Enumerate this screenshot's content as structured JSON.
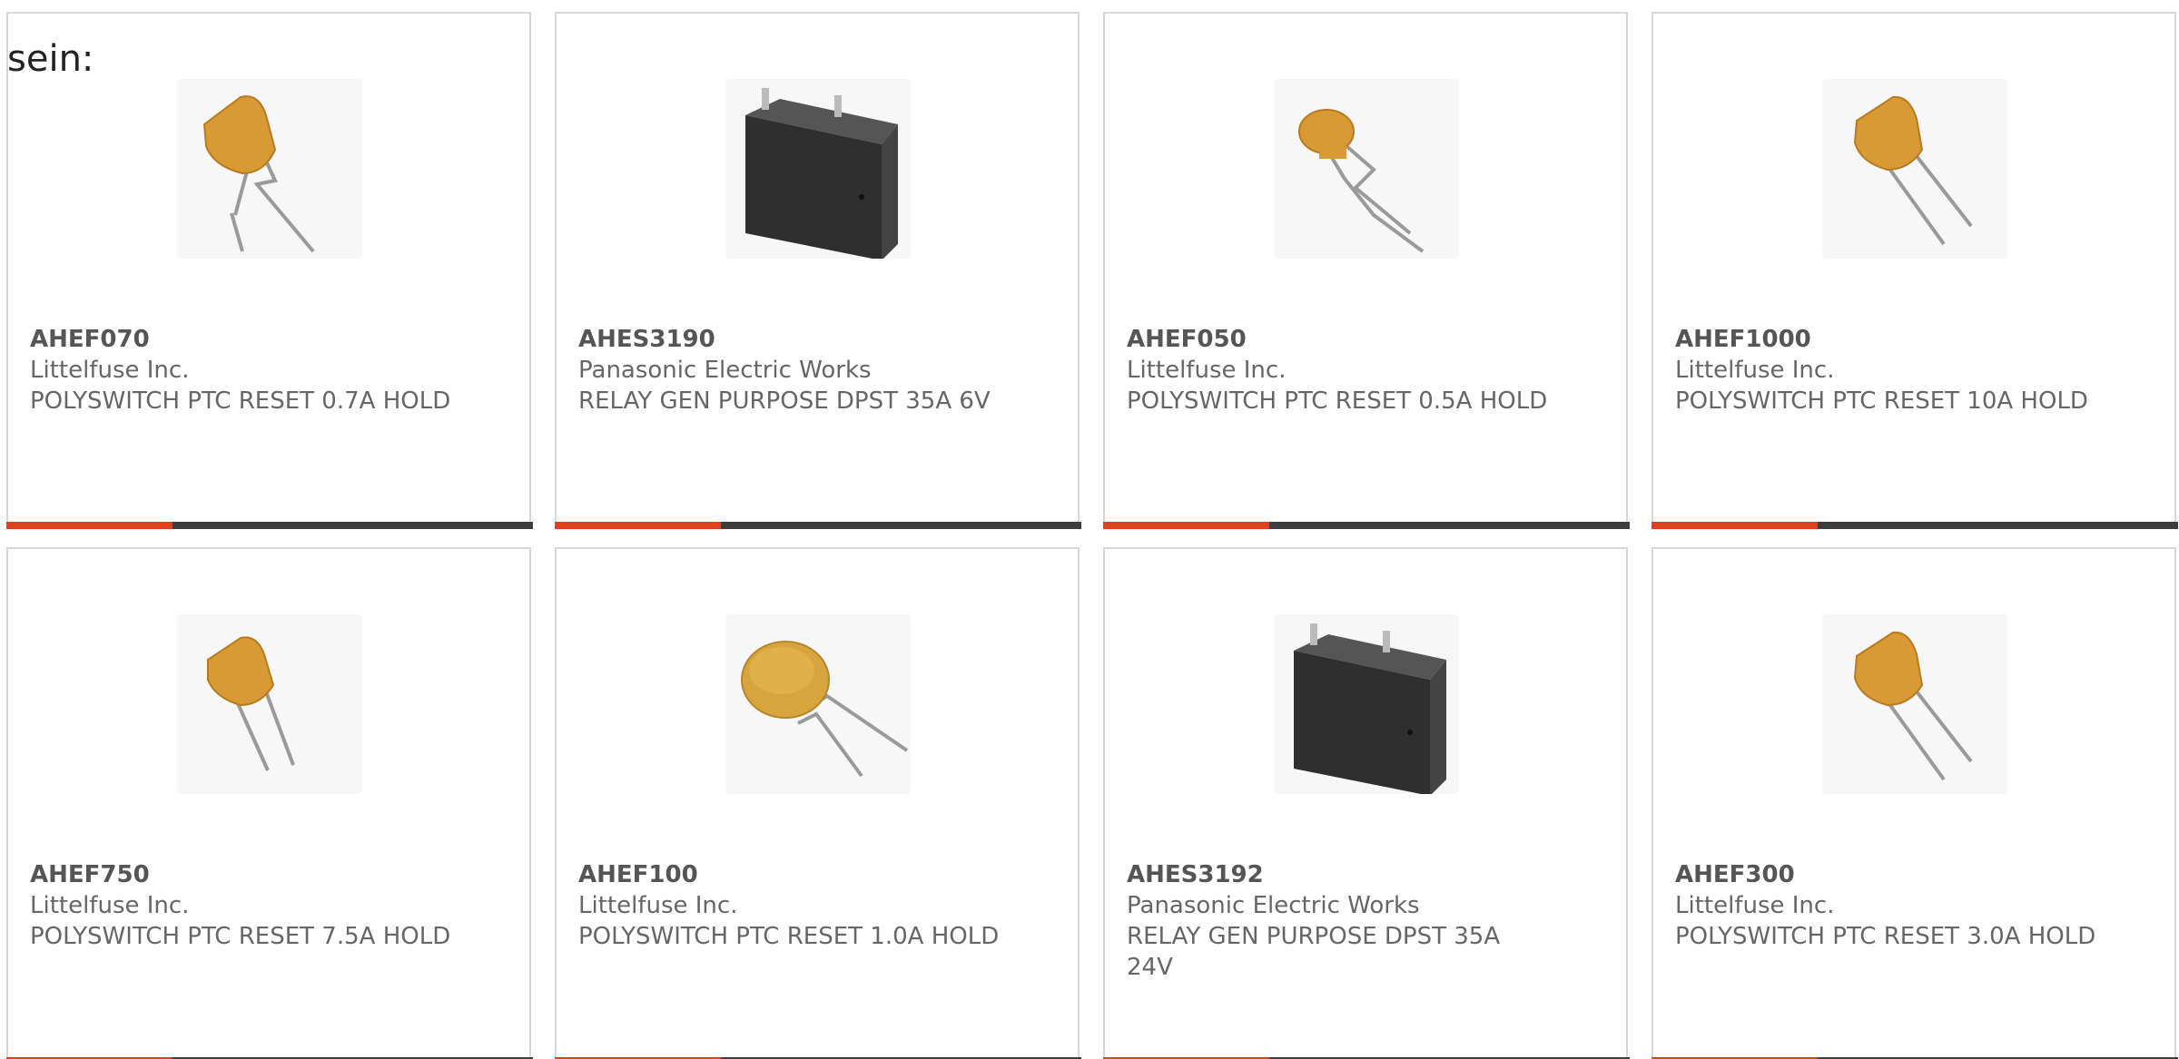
{
  "intro_text": "sein:",
  "colors": {
    "accent": "#e2401c",
    "bar": "#3d3d3d",
    "text": "#666666",
    "border": "#d8d8d8"
  },
  "products": [
    {
      "part_number": "AHEF070",
      "manufacturer": "Littelfuse Inc.",
      "description": "POLYSWITCH PTC RESET 0.7A HOLD",
      "image_icon": "ptc-resettable-fuse-icon"
    },
    {
      "part_number": "AHES3190",
      "manufacturer": "Panasonic Electric Works",
      "description": "RELAY GEN PURPOSE DPST 35A 6V",
      "image_icon": "relay-icon"
    },
    {
      "part_number": "AHEF050",
      "manufacturer": "Littelfuse Inc.",
      "description": "POLYSWITCH PTC RESET 0.5A HOLD",
      "image_icon": "ptc-resettable-fuse-icon"
    },
    {
      "part_number": "AHEF1000",
      "manufacturer": "Littelfuse Inc.",
      "description": "POLYSWITCH PTC RESET 10A HOLD",
      "image_icon": "ptc-resettable-fuse-icon"
    },
    {
      "part_number": "AHEF750",
      "manufacturer": "Littelfuse Inc.",
      "description": "POLYSWITCH PTC RESET 7.5A HOLD",
      "image_icon": "ptc-resettable-fuse-icon"
    },
    {
      "part_number": "AHEF100",
      "manufacturer": "Littelfuse Inc.",
      "description": "POLYSWITCH PTC RESET 1.0A HOLD",
      "image_icon": "ptc-resettable-fuse-disc-icon"
    },
    {
      "part_number": "AHES3192",
      "manufacturer": "Panasonic Electric Works",
      "description": "RELAY GEN PURPOSE DPST 35A 24V",
      "image_icon": "relay-icon"
    },
    {
      "part_number": "AHEF300",
      "manufacturer": "Littelfuse Inc.",
      "description": "POLYSWITCH PTC RESET 3.0A HOLD",
      "image_icon": "ptc-resettable-fuse-icon"
    }
  ]
}
